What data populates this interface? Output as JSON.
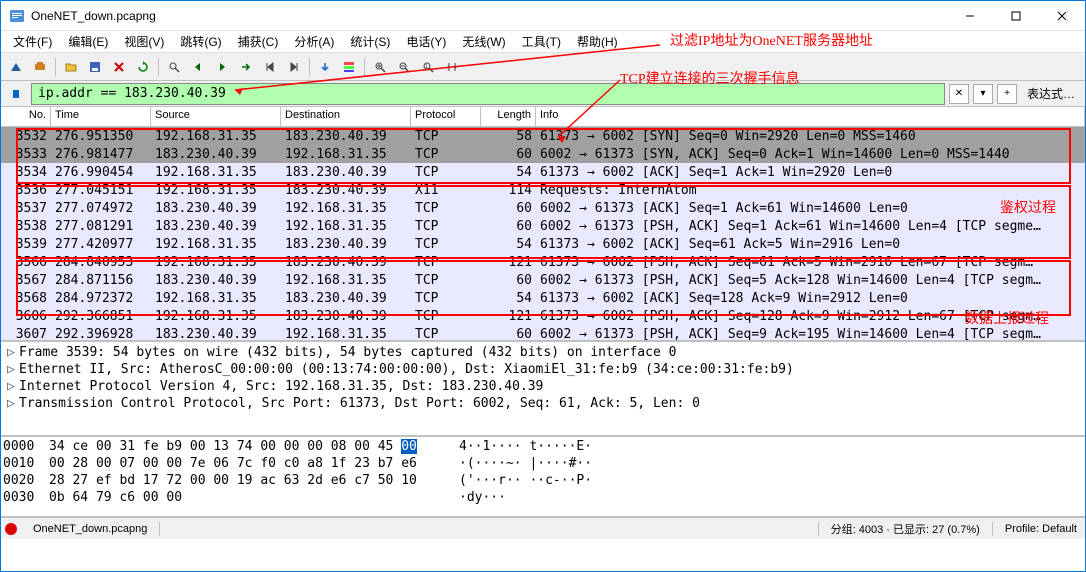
{
  "window": {
    "title": "OneNET_down.pcapng"
  },
  "menu": {
    "file": "文件(F)",
    "edit": "编辑(E)",
    "view": "视图(V)",
    "go": "跳转(G)",
    "capture": "捕获(C)",
    "analyze": "分析(A)",
    "stats": "统计(S)",
    "telephony": "电话(Y)",
    "wireless": "无线(W)",
    "tools": "工具(T)",
    "help": "帮助(H)"
  },
  "filter": {
    "value": "ip.addr == 183.230.40.39",
    "expr": "表达式…"
  },
  "cols": {
    "no": "No.",
    "time": "Time",
    "src": "Source",
    "dst": "Destination",
    "proto": "Protocol",
    "len": "Length",
    "info": "Info"
  },
  "rows": [
    {
      "no": "3532",
      "time": "276.951350",
      "src": "192.168.31.35",
      "dst": "183.230.40.39",
      "proto": "TCP",
      "len": "58",
      "info": "61373 → 6002 [SYN] Seq=0 Win=2920 Len=0 MSS=1460",
      "bg": "gray"
    },
    {
      "no": "3533",
      "time": "276.981477",
      "src": "183.230.40.39",
      "dst": "192.168.31.35",
      "proto": "TCP",
      "len": "60",
      "info": "6002 → 61373 [SYN, ACK] Seq=0 Ack=1 Win=14600 Len=0 MSS=1440",
      "bg": "gray"
    },
    {
      "no": "3534",
      "time": "276.990454",
      "src": "192.168.31.35",
      "dst": "183.230.40.39",
      "proto": "TCP",
      "len": "54",
      "info": "61373 → 6002 [ACK] Seq=1 Ack=1 Win=2920 Len=0",
      "bg": "blue"
    },
    {
      "no": "3536",
      "time": "277.045151",
      "src": "192.168.31.35",
      "dst": "183.230.40.39",
      "proto": "X11",
      "len": "114",
      "info": "Requests: InternAtom",
      "bg": "blue"
    },
    {
      "no": "3537",
      "time": "277.074972",
      "src": "183.230.40.39",
      "dst": "192.168.31.35",
      "proto": "TCP",
      "len": "60",
      "info": "6002 → 61373 [ACK] Seq=1 Ack=61 Win=14600 Len=0",
      "bg": "blue"
    },
    {
      "no": "3538",
      "time": "277.081291",
      "src": "183.230.40.39",
      "dst": "192.168.31.35",
      "proto": "TCP",
      "len": "60",
      "info": "6002 → 61373 [PSH, ACK] Seq=1 Ack=61 Win=14600 Len=4 [TCP segme…",
      "bg": "blue"
    },
    {
      "no": "3539",
      "time": "277.420977",
      "src": "192.168.31.35",
      "dst": "183.230.40.39",
      "proto": "TCP",
      "len": "54",
      "info": "61373 → 6002 [ACK] Seq=61 Ack=5 Win=2916 Len=0",
      "bg": "blue"
    },
    {
      "no": "3566",
      "time": "284.840953",
      "src": "192.168.31.35",
      "dst": "183.230.40.39",
      "proto": "TCP",
      "len": "121",
      "info": "61373 → 6002 [PSH, ACK] Seq=61 Ack=5 Win=2916 Len=67 [TCP segm…",
      "bg": "blue"
    },
    {
      "no": "3567",
      "time": "284.871156",
      "src": "183.230.40.39",
      "dst": "192.168.31.35",
      "proto": "TCP",
      "len": "60",
      "info": "6002 → 61373 [PSH, ACK] Seq=5 Ack=128 Win=14600 Len=4 [TCP segm…",
      "bg": "blue"
    },
    {
      "no": "3568",
      "time": "284.972372",
      "src": "192.168.31.35",
      "dst": "183.230.40.39",
      "proto": "TCP",
      "len": "54",
      "info": "61373 → 6002 [ACK] Seq=128 Ack=9 Win=2912 Len=0",
      "bg": "blue"
    },
    {
      "no": "3606",
      "time": "292.366851",
      "src": "192.168.31.35",
      "dst": "183.230.40.39",
      "proto": "TCP",
      "len": "121",
      "info": "61373 → 6002 [PSH, ACK] Seq=128 Ack=9 Win=2912 Len=67 [TCP segm…",
      "bg": "blue"
    },
    {
      "no": "3607",
      "time": "292.396928",
      "src": "183.230.40.39",
      "dst": "192.168.31.35",
      "proto": "TCP",
      "len": "60",
      "info": "6002 → 61373 [PSH, ACK] Seq=9 Ack=195 Win=14600 Len=4 [TCP segm…",
      "bg": "blue"
    }
  ],
  "details": [
    "Frame 3539: 54 bytes on wire (432 bits), 54 bytes captured (432 bits) on interface 0",
    "Ethernet II, Src: AtherosC_00:00:00 (00:13:74:00:00:00), Dst: XiaomiEl_31:fe:b9 (34:ce:00:31:fe:b9)",
    "Internet Protocol Version 4, Src: 192.168.31.35, Dst: 183.230.40.39",
    "Transmission Control Protocol, Src Port: 61373, Dst Port: 6002, Seq: 61, Ack: 5, Len: 0"
  ],
  "hex": [
    {
      "off": "0000",
      "hex": "34 ce 00 31 fe b9 00 13  74 00 00 00 08 00 45 ",
      "hexsel": "00",
      "asc": "4··1····  t·····E·"
    },
    {
      "off": "0010",
      "hex": "00 28 00 07 00 00 7e 06  7c f0 c0 a8 1f 23 b7 e6",
      "asc": "·(····~·  |····#··"
    },
    {
      "off": "0020",
      "hex": "28 27 ef bd 17 72 00 00  19 ac 63 2d e6 c7 50 10",
      "asc": "('···r··  ··c-··P·"
    },
    {
      "off": "0030",
      "hex": "0b 64 79 c6 00 00",
      "asc": "·dy···"
    }
  ],
  "annotations": {
    "a1": "过滤IP地址为OneNET服务器地址",
    "a2": "TCP建立连接的三次握手信息",
    "a3": "鉴权过程",
    "a4": "数据上报过程"
  },
  "status": {
    "file": "OneNET_down.pcapng",
    "pkts": "分组: 4003 · 已显示: 27 (0.7%)",
    "profile": "Profile: Default"
  }
}
